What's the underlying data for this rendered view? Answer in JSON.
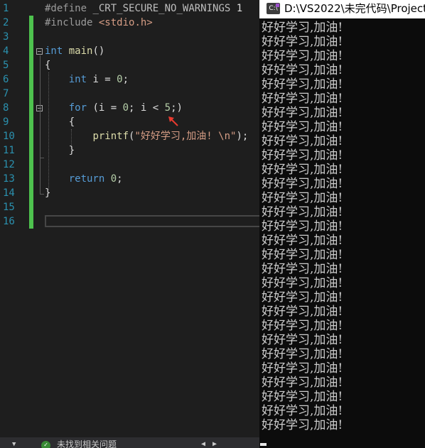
{
  "editor": {
    "line_numbers": [
      "1",
      "2",
      "3",
      "4",
      "5",
      "6",
      "7",
      "8",
      "9",
      "10",
      "11",
      "12",
      "13",
      "14",
      "15",
      "16"
    ],
    "code": {
      "l1_directive": "#define",
      "l1_macro": "_CRT_SECURE_NO_WARNINGS",
      "l1_value": "1",
      "l2_directive": "#include",
      "l2_header": "<stdio.h>",
      "l4_type": "int",
      "l4_func": "main",
      "l4_parens": "()",
      "l5": "{",
      "l6_type": "int",
      "l6_rest": "i = ",
      "l6_num": "0",
      "l6_end": ";",
      "l8_kw": "for",
      "l8_a": "(i = ",
      "l8_n1": "0",
      "l8_b": "; i < ",
      "l8_n2": "5",
      "l8_c": ";)",
      "l9": "{",
      "l10_func": "printf",
      "l10_open": "(",
      "l10_str": "\"好好学习,加油! \\n\"",
      "l10_close": ");",
      "l11": "}",
      "l13_kw": "return",
      "l13_num": "0",
      "l13_end": ";",
      "l14": "}"
    }
  },
  "status_bar": {
    "text": "未找到相关问题",
    "check_glyph": "✓",
    "dropdown_glyph": "▼",
    "nav_glyphs": "◀ ▶"
  },
  "console": {
    "title": "D:\\VS2022\\未完代码\\Project",
    "icon_label": "C:\\",
    "lines": [
      "好好学习,加油!",
      "好好学习,加油!",
      "好好学习,加油!",
      "好好学习,加油!",
      "好好学习,加油!",
      "好好学习,加油!",
      "好好学习,加油!",
      "好好学习,加油!",
      "好好学习,加油!",
      "好好学习,加油!",
      "好好学习,加油!",
      "好好学习,加油!",
      "好好学习,加油!",
      "好好学习,加油!",
      "好好学习,加油!",
      "好好学习,加油!",
      "好好学习,加油!",
      "好好学习,加油!",
      "好好学习,加油!",
      "好好学习,加油!",
      "好好学习,加油!",
      "好好学习,加油!",
      "好好学习,加油!",
      "好好学习,加油!",
      "好好学习,加油!",
      "好好学习,加油!",
      "好好学习,加油!",
      "好好学习,加油!",
      "好好学习,加油!"
    ]
  },
  "colors": {
    "editor_bg": "#1e1e1e",
    "console_bg": "#0c0c0c",
    "change_bar": "#4ec24e",
    "annotation_arrow": "#e83a2f"
  }
}
